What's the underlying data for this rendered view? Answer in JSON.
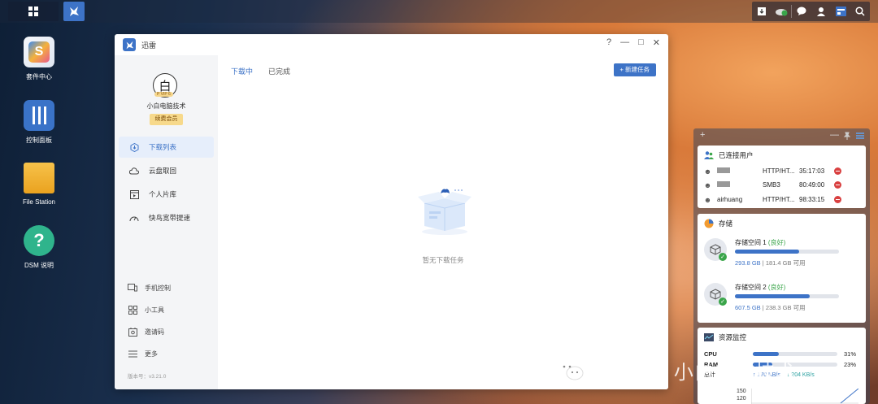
{
  "desktop": {
    "icons": [
      {
        "label": "套件中心"
      },
      {
        "label": "控制面板"
      },
      {
        "label": "File Station"
      },
      {
        "label": "DSM 说明"
      }
    ]
  },
  "window": {
    "title": "迅雷",
    "controls": {
      "help": "?",
      "minimize": "—",
      "maximize": "□",
      "close": "✕"
    },
    "profile": {
      "avatar_char": "白",
      "vip_tag": "P VIP 6",
      "username": "小白电脑技术",
      "renew_label": "续费会员"
    },
    "nav": [
      {
        "label": "下载列表"
      },
      {
        "label": "云盘取回"
      },
      {
        "label": "个人片库"
      },
      {
        "label": "快鸟宽带提速"
      }
    ],
    "bottom_nav": [
      {
        "label": "手机控制"
      },
      {
        "label": "小工具"
      },
      {
        "label": "邀请码"
      },
      {
        "label": "更多"
      }
    ],
    "version": "版本号：v3.21.0",
    "tabs": [
      {
        "label": "下载中"
      },
      {
        "label": "已完成"
      }
    ],
    "new_task_label": "+ 新建任务",
    "empty_text": "暂无下载任务"
  },
  "widgets": {
    "header": {
      "add": "+",
      "minimize": "—"
    },
    "connected_users": {
      "title": "已连接用户",
      "rows": [
        {
          "name": "",
          "protocol": "HTTP/HT...",
          "duration": "35:17:03"
        },
        {
          "name": "",
          "protocol": "SMB3",
          "duration": "80:49:00"
        },
        {
          "name": "airhuang",
          "protocol": "HTTP/HT...",
          "duration": "98:33:15"
        }
      ]
    },
    "storage": {
      "title": "存储",
      "volumes": [
        {
          "name": "存储空间 1",
          "status": "(良好)",
          "used": "293.8 GB",
          "free": "181.4 GB 可用",
          "fraction": 0.62
        },
        {
          "name": "存储空间 2",
          "status": "(良好)",
          "used": "607.5 GB",
          "free": "238.3 GB 可用",
          "fraction": 0.72
        }
      ]
    },
    "resource_monitor": {
      "title": "资源监控",
      "cpu_label": "CPU",
      "cpu_value": "31%",
      "cpu_fraction": 0.31,
      "ram_label": "RAM",
      "ram_value": "23%",
      "ram_fraction": 0.23,
      "net_label": "总计",
      "net_up": "↑ 170 KB/s",
      "net_down": "↓ 204 KB/s",
      "axis_top": "150",
      "axis_second": "120"
    }
  },
  "watermark": {
    "text": "公众号 · 小白电脑技术"
  },
  "colors": {
    "accent": "#3d73c7",
    "good": "#3aa54a",
    "danger": "#d94040"
  }
}
